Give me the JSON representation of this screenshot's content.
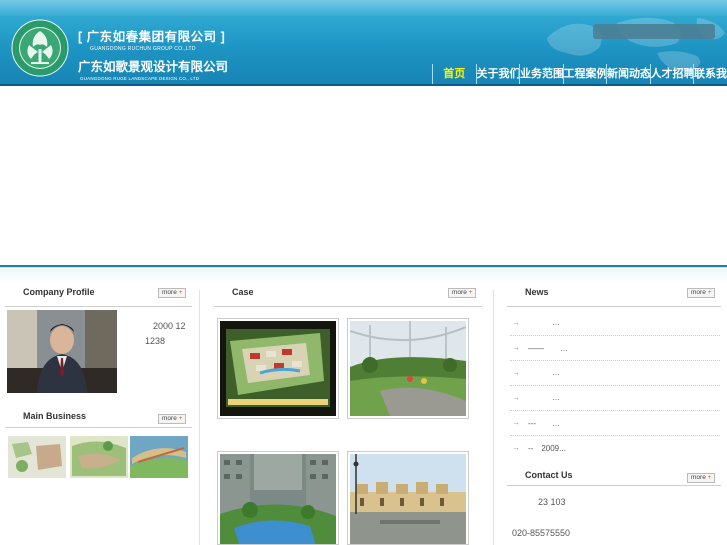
{
  "header": {
    "company_cn": "[ 广东如春集团有限公司 ]",
    "company_en": "GUANGDONG RUCHUN GROUP CO.,LTD",
    "subsidiary_cn": "广东如歌景观设计有限公司",
    "subsidiary_en": "GUANGDONG RUGE LANDSCAPE DESIGN CO., LTD",
    "brand_color": "#1e95c4"
  },
  "nav": {
    "items": [
      {
        "label": "首页",
        "active": true
      },
      {
        "label": "关于我们",
        "active": false
      },
      {
        "label": "业务范围",
        "active": false
      },
      {
        "label": "工程案例",
        "active": false
      },
      {
        "label": "新闻动态",
        "active": false
      },
      {
        "label": "人才招聘",
        "active": false
      },
      {
        "label": "联系我们",
        "active": false
      }
    ]
  },
  "profile": {
    "title": "Company Profile",
    "more": "more",
    "line1": "2000 12",
    "line2": "1238"
  },
  "business": {
    "title": "Main Business",
    "more": "more"
  },
  "case": {
    "title": "Case",
    "more": "more"
  },
  "news": {
    "title": "News",
    "more": "more",
    "items": [
      "…",
      "——　　…",
      "…",
      "…",
      "---　　…",
      "--　2009..."
    ]
  },
  "contact": {
    "title": "Contact Us",
    "more": "more",
    "address": "23 103",
    "phone": "020-85575550"
  }
}
